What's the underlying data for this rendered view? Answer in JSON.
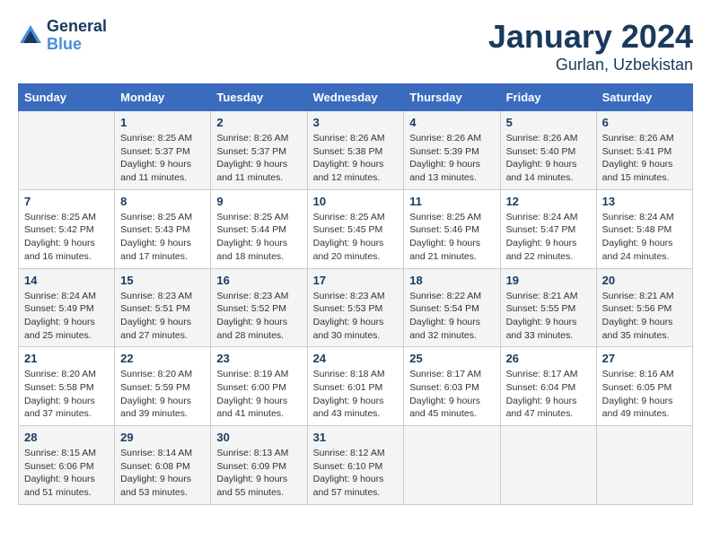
{
  "header": {
    "logo_line1": "General",
    "logo_line2": "Blue",
    "month": "January 2024",
    "location": "Gurlan, Uzbekistan"
  },
  "days_of_week": [
    "Sunday",
    "Monday",
    "Tuesday",
    "Wednesday",
    "Thursday",
    "Friday",
    "Saturday"
  ],
  "weeks": [
    [
      {
        "day": "",
        "info": ""
      },
      {
        "day": "1",
        "info": "Sunrise: 8:25 AM\nSunset: 5:37 PM\nDaylight: 9 hours\nand 11 minutes."
      },
      {
        "day": "2",
        "info": "Sunrise: 8:26 AM\nSunset: 5:37 PM\nDaylight: 9 hours\nand 11 minutes."
      },
      {
        "day": "3",
        "info": "Sunrise: 8:26 AM\nSunset: 5:38 PM\nDaylight: 9 hours\nand 12 minutes."
      },
      {
        "day": "4",
        "info": "Sunrise: 8:26 AM\nSunset: 5:39 PM\nDaylight: 9 hours\nand 13 minutes."
      },
      {
        "day": "5",
        "info": "Sunrise: 8:26 AM\nSunset: 5:40 PM\nDaylight: 9 hours\nand 14 minutes."
      },
      {
        "day": "6",
        "info": "Sunrise: 8:26 AM\nSunset: 5:41 PM\nDaylight: 9 hours\nand 15 minutes."
      }
    ],
    [
      {
        "day": "7",
        "info": "Sunrise: 8:25 AM\nSunset: 5:42 PM\nDaylight: 9 hours\nand 16 minutes."
      },
      {
        "day": "8",
        "info": "Sunrise: 8:25 AM\nSunset: 5:43 PM\nDaylight: 9 hours\nand 17 minutes."
      },
      {
        "day": "9",
        "info": "Sunrise: 8:25 AM\nSunset: 5:44 PM\nDaylight: 9 hours\nand 18 minutes."
      },
      {
        "day": "10",
        "info": "Sunrise: 8:25 AM\nSunset: 5:45 PM\nDaylight: 9 hours\nand 20 minutes."
      },
      {
        "day": "11",
        "info": "Sunrise: 8:25 AM\nSunset: 5:46 PM\nDaylight: 9 hours\nand 21 minutes."
      },
      {
        "day": "12",
        "info": "Sunrise: 8:24 AM\nSunset: 5:47 PM\nDaylight: 9 hours\nand 22 minutes."
      },
      {
        "day": "13",
        "info": "Sunrise: 8:24 AM\nSunset: 5:48 PM\nDaylight: 9 hours\nand 24 minutes."
      }
    ],
    [
      {
        "day": "14",
        "info": "Sunrise: 8:24 AM\nSunset: 5:49 PM\nDaylight: 9 hours\nand 25 minutes."
      },
      {
        "day": "15",
        "info": "Sunrise: 8:23 AM\nSunset: 5:51 PM\nDaylight: 9 hours\nand 27 minutes."
      },
      {
        "day": "16",
        "info": "Sunrise: 8:23 AM\nSunset: 5:52 PM\nDaylight: 9 hours\nand 28 minutes."
      },
      {
        "day": "17",
        "info": "Sunrise: 8:23 AM\nSunset: 5:53 PM\nDaylight: 9 hours\nand 30 minutes."
      },
      {
        "day": "18",
        "info": "Sunrise: 8:22 AM\nSunset: 5:54 PM\nDaylight: 9 hours\nand 32 minutes."
      },
      {
        "day": "19",
        "info": "Sunrise: 8:21 AM\nSunset: 5:55 PM\nDaylight: 9 hours\nand 33 minutes."
      },
      {
        "day": "20",
        "info": "Sunrise: 8:21 AM\nSunset: 5:56 PM\nDaylight: 9 hours\nand 35 minutes."
      }
    ],
    [
      {
        "day": "21",
        "info": "Sunrise: 8:20 AM\nSunset: 5:58 PM\nDaylight: 9 hours\nand 37 minutes."
      },
      {
        "day": "22",
        "info": "Sunrise: 8:20 AM\nSunset: 5:59 PM\nDaylight: 9 hours\nand 39 minutes."
      },
      {
        "day": "23",
        "info": "Sunrise: 8:19 AM\nSunset: 6:00 PM\nDaylight: 9 hours\nand 41 minutes."
      },
      {
        "day": "24",
        "info": "Sunrise: 8:18 AM\nSunset: 6:01 PM\nDaylight: 9 hours\nand 43 minutes."
      },
      {
        "day": "25",
        "info": "Sunrise: 8:17 AM\nSunset: 6:03 PM\nDaylight: 9 hours\nand 45 minutes."
      },
      {
        "day": "26",
        "info": "Sunrise: 8:17 AM\nSunset: 6:04 PM\nDaylight: 9 hours\nand 47 minutes."
      },
      {
        "day": "27",
        "info": "Sunrise: 8:16 AM\nSunset: 6:05 PM\nDaylight: 9 hours\nand 49 minutes."
      }
    ],
    [
      {
        "day": "28",
        "info": "Sunrise: 8:15 AM\nSunset: 6:06 PM\nDaylight: 9 hours\nand 51 minutes."
      },
      {
        "day": "29",
        "info": "Sunrise: 8:14 AM\nSunset: 6:08 PM\nDaylight: 9 hours\nand 53 minutes."
      },
      {
        "day": "30",
        "info": "Sunrise: 8:13 AM\nSunset: 6:09 PM\nDaylight: 9 hours\nand 55 minutes."
      },
      {
        "day": "31",
        "info": "Sunrise: 8:12 AM\nSunset: 6:10 PM\nDaylight: 9 hours\nand 57 minutes."
      },
      {
        "day": "",
        "info": ""
      },
      {
        "day": "",
        "info": ""
      },
      {
        "day": "",
        "info": ""
      }
    ]
  ]
}
